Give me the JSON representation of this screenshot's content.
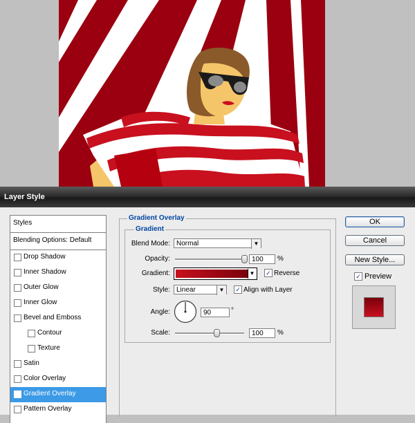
{
  "dialog": {
    "title": "Layer Style"
  },
  "styles_list": {
    "header": "Styles",
    "blending": "Blending Options: Default",
    "items": [
      {
        "label": "Drop Shadow",
        "checked": false,
        "selected": false,
        "indent": false
      },
      {
        "label": "Inner Shadow",
        "checked": false,
        "selected": false,
        "indent": false
      },
      {
        "label": "Outer Glow",
        "checked": false,
        "selected": false,
        "indent": false
      },
      {
        "label": "Inner Glow",
        "checked": false,
        "selected": false,
        "indent": false
      },
      {
        "label": "Bevel and Emboss",
        "checked": false,
        "selected": false,
        "indent": false
      },
      {
        "label": "Contour",
        "checked": false,
        "selected": false,
        "indent": true
      },
      {
        "label": "Texture",
        "checked": false,
        "selected": false,
        "indent": true
      },
      {
        "label": "Satin",
        "checked": false,
        "selected": false,
        "indent": false
      },
      {
        "label": "Color Overlay",
        "checked": false,
        "selected": false,
        "indent": false
      },
      {
        "label": "Gradient Overlay",
        "checked": true,
        "selected": true,
        "indent": false
      },
      {
        "label": "Pattern Overlay",
        "checked": false,
        "selected": false,
        "indent": false
      }
    ]
  },
  "panel": {
    "section_title": "Gradient Overlay",
    "group_title": "Gradient",
    "blend_mode_label": "Blend Mode:",
    "blend_mode_value": "Normal",
    "opacity_label": "Opacity:",
    "opacity_value": "100",
    "opacity_unit": "%",
    "opacity_level": 1.0,
    "gradient_label": "Gradient:",
    "gradient_colors": [
      "#c8101e",
      "#7a000c"
    ],
    "reverse_label": "Reverse",
    "reverse_checked": true,
    "style_label": "Style:",
    "style_value": "Linear",
    "align_label": "Align with Layer",
    "align_checked": true,
    "angle_label": "Angle:",
    "angle_value": "90",
    "angle_unit": "°",
    "scale_label": "Scale:",
    "scale_value": "100",
    "scale_unit": "%",
    "scale_level": 0.6
  },
  "buttons": {
    "ok": "OK",
    "cancel": "Cancel",
    "new_style": "New Style...",
    "preview_label": "Preview",
    "preview_checked": true
  },
  "icons": {
    "dropdown": "chevron-down-icon",
    "check": "checkmark-icon"
  },
  "colors": {
    "accent_blue": "#0045a0",
    "selection": "#3c9ae6",
    "stripe_red": "#c8101e",
    "dark_red": "#7a000c"
  }
}
